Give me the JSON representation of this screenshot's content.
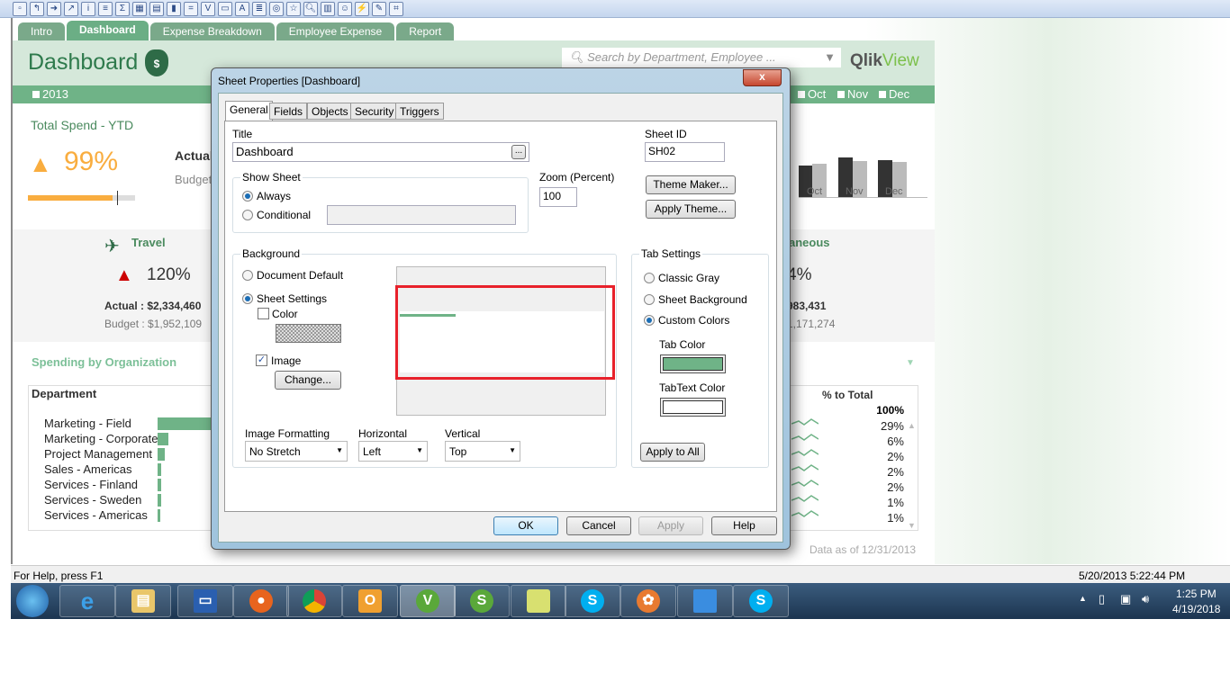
{
  "toolbar": {
    "icons": [
      "new",
      "open",
      "save",
      "save-as",
      "info",
      "listbox",
      "statistics",
      "table",
      "multibox",
      "chart",
      "input",
      "current-selections",
      "button",
      "text",
      "line",
      "slider",
      "bookmark",
      "search",
      "container",
      "smiley",
      "wizard",
      "design",
      "layout"
    ]
  },
  "sheet_tabs": [
    {
      "label": "Intro"
    },
    {
      "label": "Dashboard"
    },
    {
      "label": "Expense Breakdown"
    },
    {
      "label": "Employee Expense"
    },
    {
      "label": "Report"
    }
  ],
  "header": {
    "title": "Dashboard",
    "search_placeholder": "Search by Department, Employee ...",
    "logo_qlik": "Qlik",
    "logo_view": "View"
  },
  "months": {
    "year": "2013",
    "items": [
      "Oct",
      "Nov",
      "Dec"
    ]
  },
  "total_spend": {
    "title": "Total Spend - YTD",
    "percent": "99%",
    "progress": 0.99,
    "actual_label": "Actual",
    "budget_label": "Budget"
  },
  "month_chart": {
    "categories": [
      "Oct",
      "Nov",
      "Dec"
    ]
  },
  "travel": {
    "title": "Travel",
    "percent": "120%",
    "actual": "Actual : $2,334,460",
    "budget": "Budget : $1,952,109"
  },
  "misc": {
    "title": "aneous",
    "percent": "4%",
    "actual": "983,431",
    "budget": "1,171,274"
  },
  "spending": {
    "title": "Spending by Organization",
    "col_dept": "Department",
    "col_pct": "% to Total",
    "total": "100%",
    "rows": [
      {
        "dept": "Marketing - Field",
        "pct": "29%",
        "share": 0.29
      },
      {
        "dept": "Marketing - Corporate",
        "pct": "6%",
        "share": 0.06
      },
      {
        "dept": "Project Management",
        "pct": "2%",
        "share": 0.04
      },
      {
        "dept": "Sales - Americas",
        "pct": "2%",
        "share": 0.02
      },
      {
        "dept": "Services - Finland",
        "pct": "2%",
        "share": 0.018
      },
      {
        "dept": "Services - Sweden",
        "pct": "1%",
        "share": 0.018
      },
      {
        "dept": "Services - Americas",
        "pct": "1%",
        "share": 0.015
      }
    ],
    "data_as_of": "Data as of 12/31/2013"
  },
  "dialog": {
    "title": "Sheet Properties [Dashboard]",
    "close": "x",
    "tabs": [
      "General",
      "Fields",
      "Objects",
      "Security",
      "Triggers"
    ],
    "title_label": "Title",
    "title_value": "Dashboard",
    "ellipsis": "...",
    "sheet_id_label": "Sheet ID",
    "sheet_id_value": "SH02",
    "show_sheet": "Show Sheet",
    "always": "Always",
    "conditional": "Conditional",
    "zoom_label": "Zoom (Percent)",
    "zoom_value": "100",
    "theme_maker": "Theme Maker...",
    "apply_theme": "Apply Theme...",
    "background": "Background",
    "document_default": "Document Default",
    "sheet_settings": "Sheet Settings",
    "color": "Color",
    "image": "Image",
    "change": "Change...",
    "image_formatting": "Image Formatting",
    "image_formatting_value": "No Stretch",
    "horizontal": "Horizontal",
    "horizontal_value": "Left",
    "vertical": "Vertical",
    "vertical_value": "Top",
    "tab_settings": "Tab Settings",
    "classic_gray": "Classic Gray",
    "sheet_background": "Sheet Background",
    "custom_colors": "Custom Colors",
    "tab_color": "Tab Color",
    "tab_color_value": "#6fb387",
    "tabtext_color": "TabText Color",
    "tabtext_color_value": "#ffffff",
    "apply_to_all": "Apply to All",
    "ok": "OK",
    "cancel": "Cancel",
    "apply": "Apply",
    "help": "Help"
  },
  "status": {
    "help": "For Help, press F1",
    "datetime": "5/20/2013 5:22:44 PM"
  },
  "taskbar": {
    "apps": [
      "windows-start",
      "internet-explorer",
      "file-explorer",
      "remote-desktop",
      "firefox",
      "chrome",
      "outlook",
      "qlikview",
      "qlik-sense",
      "sticky-notes",
      "skype",
      "app-flower",
      "monitor",
      "skype-business"
    ],
    "time": "1:25 PM",
    "date": "4/19/2018"
  }
}
